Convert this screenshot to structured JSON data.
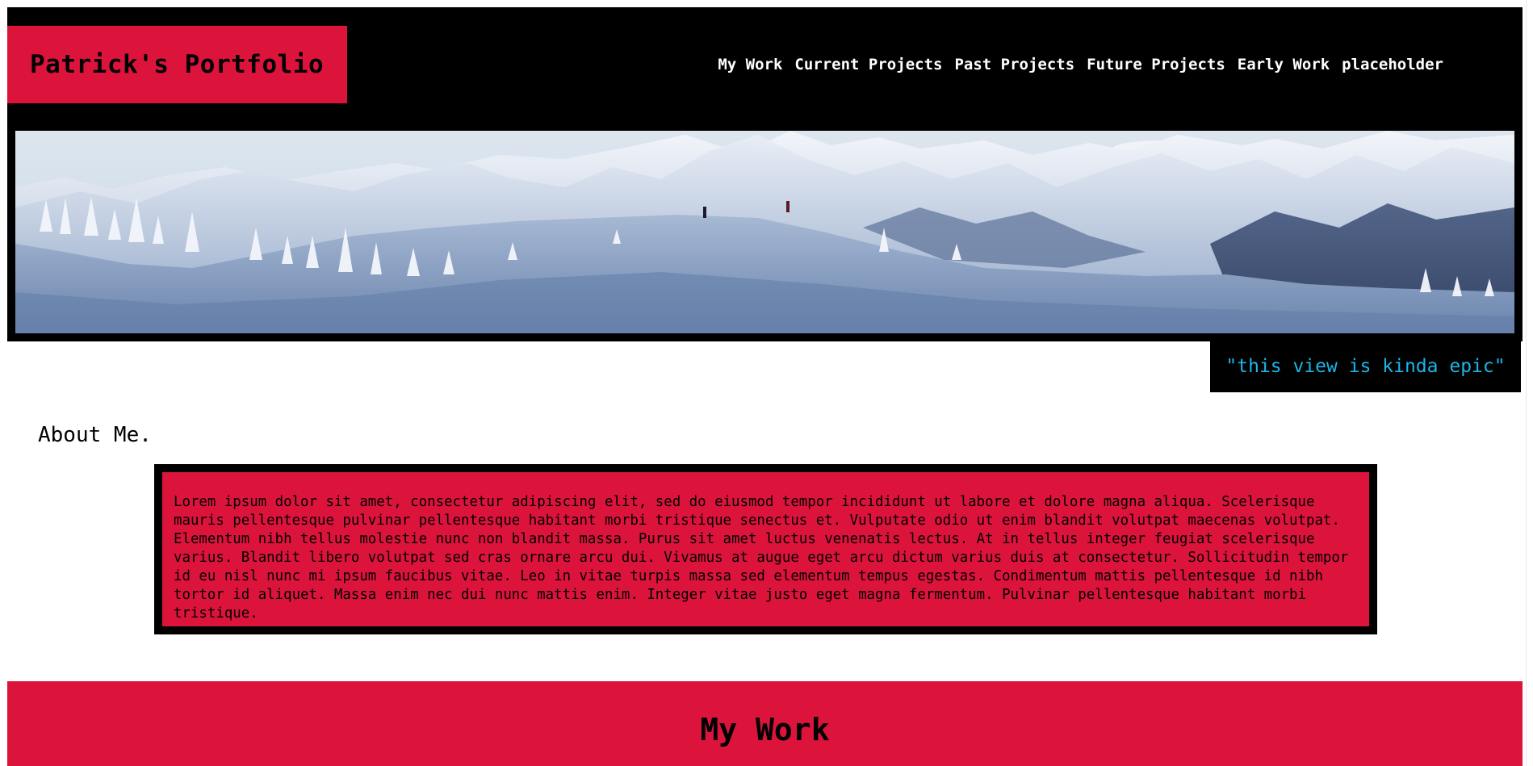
{
  "header": {
    "brand": "Patrick's Portfolio",
    "nav": [
      "My Work",
      "Current Projects",
      "Past Projects",
      "Future Projects",
      "Early Work",
      "placeholder"
    ]
  },
  "hero": {
    "caption": "\"this view is kinda epic\""
  },
  "about": {
    "heading": "About Me.",
    "body": "Lorem ipsum dolor sit amet, consectetur adipiscing elit, sed do eiusmod tempor incididunt ut labore et dolore magna aliqua. Scelerisque mauris pellentesque pulvinar pellentesque habitant morbi tristique senectus et. Vulputate odio ut enim blandit volutpat maecenas volutpat. Elementum nibh tellus molestie nunc non blandit massa. Purus sit amet luctus venenatis lectus. At in tellus integer feugiat scelerisque varius. Blandit libero volutpat sed cras ornare arcu dui. Vivamus at augue eget arcu dictum varius duis at consectetur. Sollicitudin tempor id eu nisl nunc mi ipsum faucibus vitae. Leo in vitae turpis massa sed elementum tempus egestas. Condimentum mattis pellentesque id nibh tortor id aliquet. Massa enim nec dui nunc mattis enim. Integer vitae justo eget magna fermentum. Pulvinar pellentesque habitant morbi tristique."
  },
  "work": {
    "heading": "My Work"
  },
  "colors": {
    "accent": "#dc143c",
    "header_bg": "#000000",
    "caption_text": "#1cb5e8"
  }
}
